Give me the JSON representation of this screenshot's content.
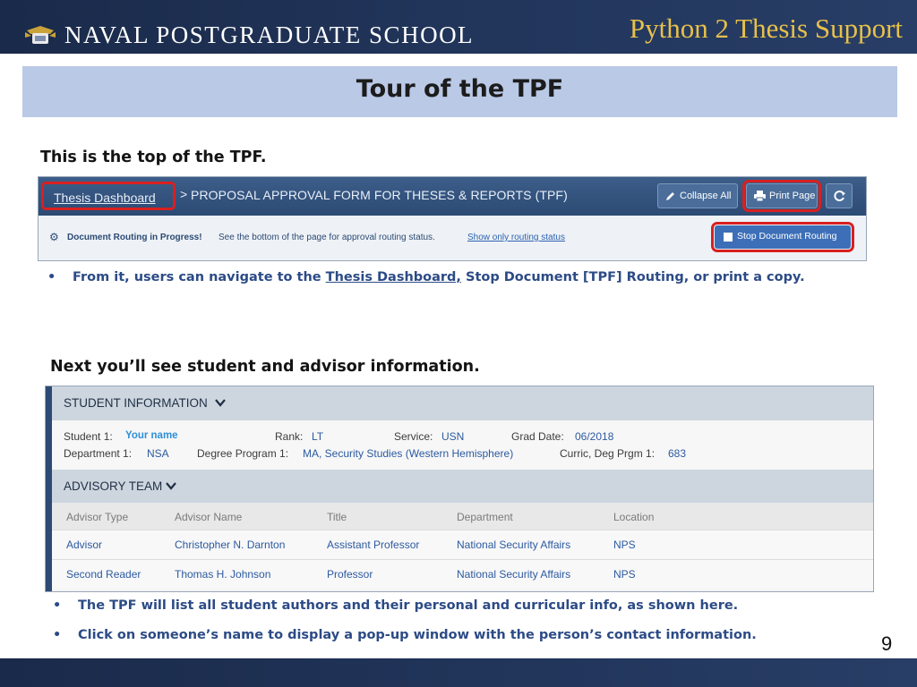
{
  "header": {
    "school_name": "NAVAL POSTGRADUATE SCHOOL",
    "deck_title": "Python 2 Thesis Support"
  },
  "slide": {
    "title": "Tour of the TPF",
    "caption_top": "This is the top of the TPF.",
    "bullet_top": {
      "prefix": "From it, users can navigate to the ",
      "link": "Thesis Dashboard,",
      "suffix": " Stop Document [TPF] Routing, or print a copy."
    },
    "caption_info": "Next you’ll see student and advisor information.",
    "bullets_bottom": [
      "The TPF will list all student authors and their personal and curricular info, as shown here.",
      "Click on someone’s name to display a pop-up window with the person’s contact information."
    ],
    "bullet_char": "•",
    "slide_number": "9"
  },
  "tpf_top": {
    "breadcrumb": "Thesis Dashboard",
    "breadcrumb_sep": ">",
    "form_title": "PROPOSAL APPROVAL FORM FOR THESES & REPORTS (TPF)",
    "collapse_all": "Collapse All",
    "print_page": "Print Page",
    "routing_bold": "Document Routing in Progress!",
    "routing_text": "See the bottom of the page for approval routing status.",
    "routing_link": "Show only routing status",
    "stop_routing": "Stop Document Routing"
  },
  "student_info": {
    "heading": "STUDENT INFORMATION",
    "row1": [
      {
        "label": "Student 1:",
        "value": "Your name"
      },
      {
        "label": "Rank:",
        "value": "LT"
      },
      {
        "label": "Service:",
        "value": "USN"
      },
      {
        "label": "Grad Date:",
        "value": "06/2018"
      }
    ],
    "row2": [
      {
        "label": "Department 1:",
        "value": "NSA"
      },
      {
        "label": "Degree Program 1:",
        "value": "MA, Security Studies (Western Hemisphere)"
      },
      {
        "label": "Curric, Deg Prgm 1:",
        "value": "683"
      }
    ]
  },
  "advisory_team": {
    "heading": "ADVISORY TEAM",
    "columns": [
      "Advisor Type",
      "Advisor Name",
      "Title",
      "Department",
      "Location"
    ],
    "rows": [
      [
        "Advisor",
        "Christopher N. Darnton",
        "Assistant Professor",
        "National Security Affairs",
        "NPS"
      ],
      [
        "Second Reader",
        "Thomas H. Johnson",
        "Professor",
        "National Security Affairs",
        "NPS"
      ]
    ]
  },
  "colors": {
    "header_navy": "#1a2a4a",
    "deck_title_gold": "#e8c14a",
    "title_bar": "#b9c9e6",
    "bullet_blue": "#2c4b86",
    "highlight_red": "#d82020"
  },
  "icons": [
    "nps-crest-icon",
    "pencil-icon",
    "printer-icon",
    "refresh-icon",
    "gear-icon",
    "checkbox-icon",
    "chevron-down-icon"
  ]
}
